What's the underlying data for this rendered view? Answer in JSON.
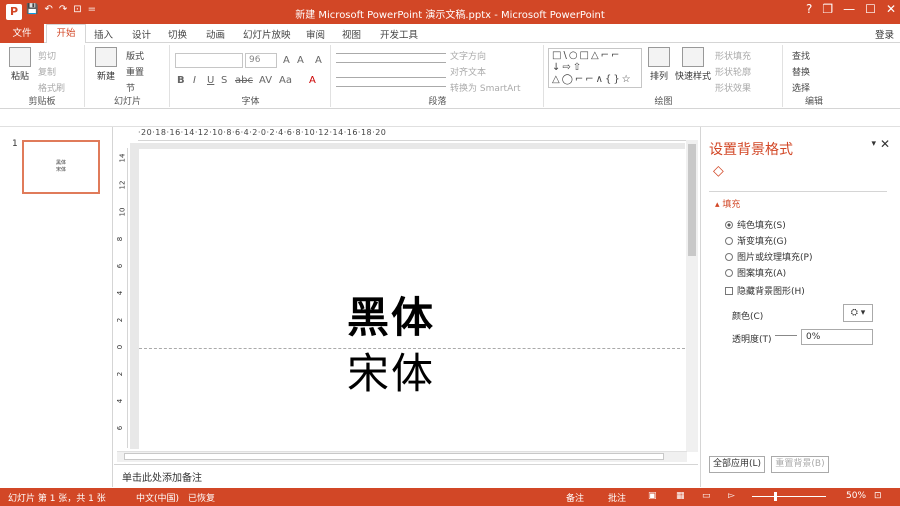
{
  "window": {
    "title": "新建 Microsoft PowerPoint 演示文稿.pptx - Microsoft PowerPoint",
    "logo": "P",
    "help": "?",
    "restore": "❐",
    "minimize": "—",
    "maximize": "☐",
    "close": "✕"
  },
  "qat": {
    "save": "💾",
    "undo": "↶",
    "redo": "↷",
    "start": "⊡",
    "more": "="
  },
  "tabs": {
    "file": "文件",
    "home": "开始",
    "insert": "插入",
    "design": "设计",
    "transitions": "切换",
    "animations": "动画",
    "slideshow": "幻灯片放映",
    "review": "审阅",
    "view": "视图",
    "developer": "开发工具",
    "login": "登录"
  },
  "ribbon": {
    "clipboard": {
      "paste": "粘贴",
      "cut": "剪切",
      "copy": "复制",
      "painter": "格式刷",
      "label": "剪贴板"
    },
    "slides": {
      "new": "新建",
      "new2": "幻灯片",
      "layout": "版式",
      "reset": "重置",
      "section": "节",
      "label": "幻灯片"
    },
    "font": {
      "size": "96",
      "bold": "B",
      "italic": "I",
      "underline": "U",
      "strike": "S",
      "shadow": "abc",
      "spacing": "AV",
      "case": "Aa",
      "color": "A",
      "grow": "A",
      "shrink": "A",
      "clear": "A",
      "label": "字体"
    },
    "paragraph": {
      "direction": "文字方向",
      "align": "对齐文本",
      "smartart": "转换为 SmartArt",
      "label": "段落"
    },
    "drawing": {
      "shapes": "□\\○□△⌐⌐ ↓⇨⇧ △◯⌐⌐∧{}☆",
      "arrange": "排列",
      "quickstyles": "快速样式",
      "fill": "形状填充",
      "outline": "形状轮廓",
      "effect": "形状效果",
      "label": "绘图"
    },
    "editing": {
      "find": "查找",
      "replace": "替换",
      "select": "选择",
      "label": "编辑"
    }
  },
  "thumbnail": {
    "number": "1",
    "line1": "黑体",
    "line2": "宋体"
  },
  "ruler": {
    "h": "·20·18·16·14·12·10·8·6·4·2·0·2·4·6·8·10·12·14·16·18·20",
    "v": [
      "14",
      "12",
      "10",
      "8",
      "6",
      "4",
      "2",
      "0",
      "2",
      "4",
      "6"
    ]
  },
  "slide": {
    "text1": "黑体",
    "text2": "宋体"
  },
  "notes": {
    "placeholder": "单击此处添加备注"
  },
  "format_pane": {
    "title": "设置背景格式",
    "fill_header": "▴ 填充",
    "solid": "纯色填充(S)",
    "gradient": "渐变填充(G)",
    "picture": "图片或纹理填充(P)",
    "pattern": "图案填充(A)",
    "hide": "隐藏背景图形(H)",
    "color_label": "颜色(C)",
    "color_btn": "⛭ ▾",
    "transparency_label": "透明度(T)",
    "transparency": "0%",
    "apply_all": "全部应用(L)",
    "reset": "重置背景(B)"
  },
  "status": {
    "slide": "幻灯片 第 1 张，共 1 张",
    "lang": "中文(中国)",
    "recovered": "已恢复",
    "notes": "备注",
    "comments": "批注",
    "zoom": "50%"
  }
}
